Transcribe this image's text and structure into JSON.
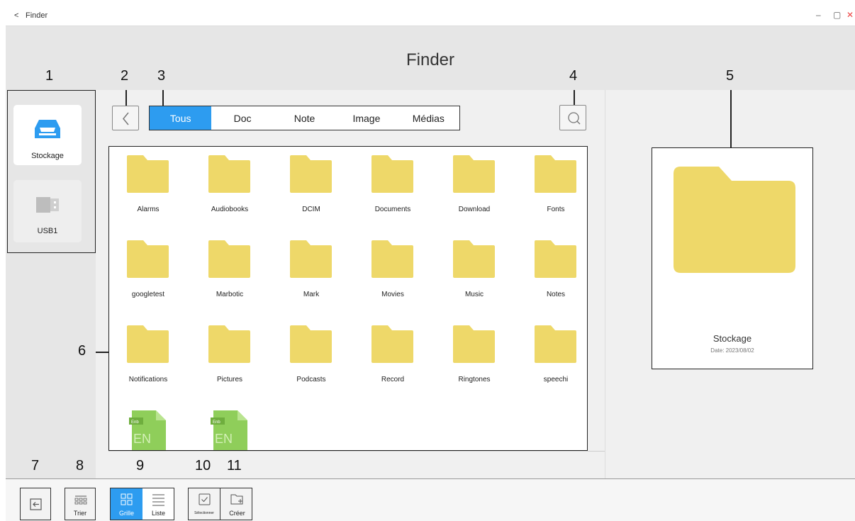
{
  "titlebar": {
    "back_glyph": "<",
    "title": "Finder"
  },
  "header": {
    "title": "Finder"
  },
  "callouts": {
    "n1": "1",
    "n2": "2",
    "n3": "3",
    "n4": "4",
    "n5": "5",
    "n6": "6",
    "n7": "7",
    "n8": "8",
    "n9": "9",
    "n10": "10",
    "n11": "11"
  },
  "sidebar": {
    "drives": [
      {
        "label": "Stockage",
        "icon": "storage-drive-icon",
        "selected": true
      },
      {
        "label": "USB1",
        "icon": "usb-drive-icon",
        "selected": false
      }
    ]
  },
  "tabs": [
    {
      "label": "Tous",
      "active": true
    },
    {
      "label": "Doc",
      "active": false
    },
    {
      "label": "Note",
      "active": false
    },
    {
      "label": "Image",
      "active": false
    },
    {
      "label": "Médias",
      "active": false
    }
  ],
  "files": [
    "Alarms",
    "Audiobooks",
    "DCIM",
    "Documents",
    "Download",
    "Fonts",
    "googletest",
    "Marbotic",
    "Mark",
    "Movies",
    "Music",
    "Notes",
    "Notifications",
    "Pictures",
    "Podcasts",
    "Record",
    "Ringtones",
    "speechi"
  ],
  "enb_files": [
    {
      "badge": "Enb",
      "text": "EN"
    },
    {
      "badge": "Enb",
      "text": "EN"
    }
  ],
  "detail": {
    "name": "Stockage",
    "date": "Date: 2023/08/02"
  },
  "bottom": {
    "sort_label": "Trier",
    "grid_label": "Grille",
    "list_label": "Liste",
    "select_label": "Sélectionner",
    "create_label": "Créer"
  },
  "colors": {
    "accent": "#2d9cf0",
    "folder": "#eed869",
    "enb": "#8fce5a"
  }
}
